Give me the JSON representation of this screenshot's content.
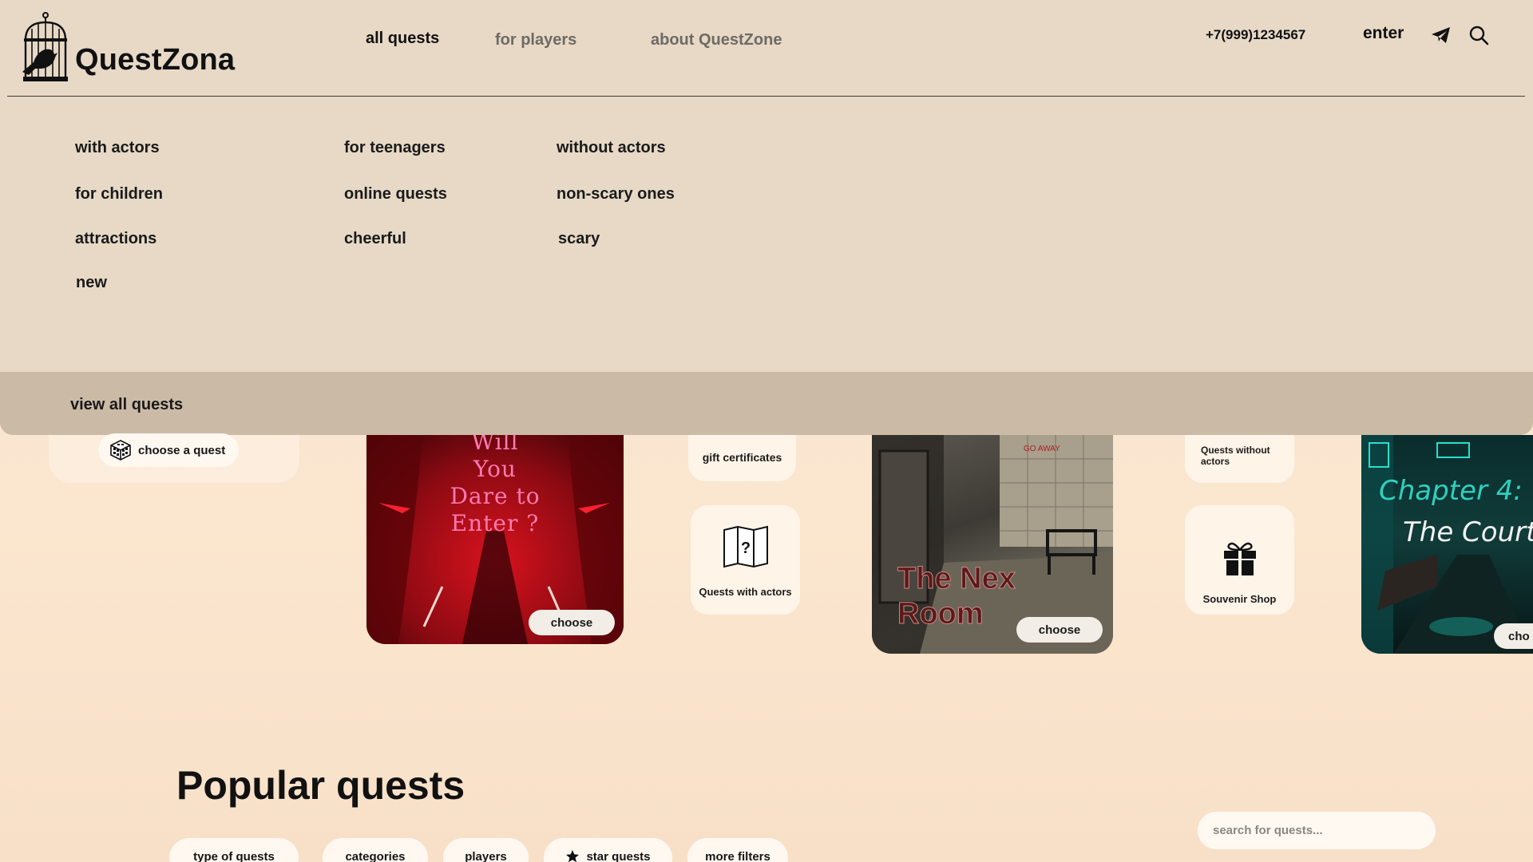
{
  "header": {
    "brand": "QuestZona",
    "nav": [
      {
        "label": "all quests"
      },
      {
        "label": "for players"
      },
      {
        "label": "about QuestZone"
      }
    ],
    "phone": "+7(999)1234567",
    "enter_label": "enter",
    "icons": [
      "birdcage-logo-icon",
      "telegram-icon",
      "search-icon"
    ]
  },
  "dropdown": {
    "columns": [
      [
        "with actors",
        "for children",
        "attractions",
        "new"
      ],
      [
        "for teenagers",
        "online quests",
        "cheerful"
      ],
      [
        "without actors",
        "non-scary ones",
        "scary"
      ]
    ],
    "footer_link": "view all quests"
  },
  "content": {
    "choose_quest": "choose a quest",
    "tiles": {
      "gift": "gift certificates",
      "with_actors": "Quests with actors",
      "without_actors": "Quests without actors",
      "souvenir": "Souvenir Shop"
    },
    "posters": [
      {
        "lines": [
          "Will",
          "You",
          "Dare to",
          "Enter ?"
        ],
        "button": "choose"
      },
      {
        "lines": [
          "The Nex",
          "Room"
        ],
        "button": "choose"
      },
      {
        "lines": [
          "Chapter 4:",
          "The Court"
        ],
        "button": "cho"
      }
    ],
    "section_title": "Popular quests",
    "search_placeholder": "search for quests...",
    "filters": [
      "type of quests",
      "categories",
      "players",
      "star quests",
      "more filters"
    ]
  },
  "colors": {
    "header_bg": "#e7d9c6",
    "dropdown_footer_bg": "#cbbba6",
    "page_bg": "#fbe6cf",
    "poster_red": "#8c0a12",
    "poster_teal": "#1fd3c0"
  }
}
